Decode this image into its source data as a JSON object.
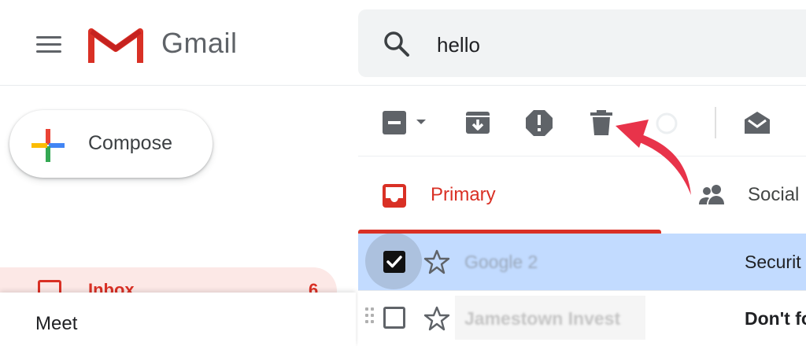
{
  "header": {
    "brand": "Gmail",
    "search": {
      "value": "hello"
    }
  },
  "sidebar": {
    "compose_label": "Compose",
    "inbox": {
      "label": "Inbox",
      "count": "6"
    }
  },
  "meet": {
    "label": "Meet"
  },
  "tabs": [
    {
      "label": "Primary",
      "icon": "inbox-tab-icon",
      "selected": true
    },
    {
      "label": "Social",
      "icon": "people-icon",
      "selected": false
    }
  ],
  "emails": [
    {
      "sender": "Google 2",
      "subject": "Securit",
      "selected": true,
      "read": true
    },
    {
      "sender": "Jamestown Invest",
      "subject": "Don't fo",
      "selected": false,
      "read": false
    }
  ],
  "colors": {
    "accent_red": "#d93025",
    "selected_row": "#c2dbff",
    "annotation_arrow": "#e8334a"
  }
}
